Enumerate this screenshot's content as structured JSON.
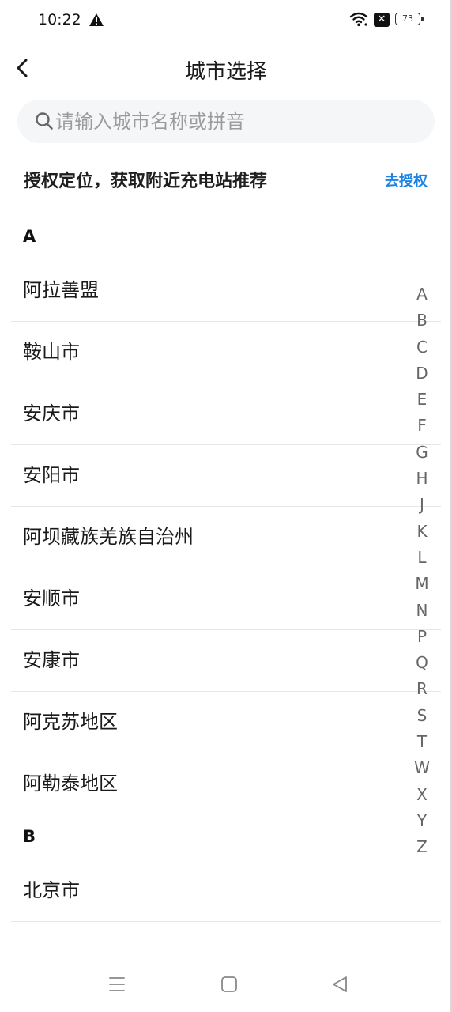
{
  "status_bar": {
    "time": "10:22",
    "battery": "73",
    "icons": [
      "warning-icon",
      "wifi-icon",
      "no-sim-icon",
      "battery-icon"
    ]
  },
  "header": {
    "title": "城市选择",
    "back_icon": "chevron-left-icon"
  },
  "search": {
    "placeholder": "请输入城市名称或拼音",
    "value": "",
    "icon": "search-icon"
  },
  "location": {
    "text": "授权定位，获取附近充电站推荐",
    "action": "去授权",
    "action_color": "#1a84e6"
  },
  "sections": [
    {
      "letter": "A",
      "cities": [
        "阿拉善盟",
        "鞍山市",
        "安庆市",
        "安阳市",
        "阿坝藏族羌族自治州",
        "安顺市",
        "安康市",
        "阿克苏地区",
        "阿勒泰地区"
      ]
    },
    {
      "letter": "B",
      "cities": [
        "北京市"
      ]
    }
  ],
  "alphabet_index": [
    "A",
    "B",
    "C",
    "D",
    "E",
    "F",
    "G",
    "H",
    "J",
    "K",
    "L",
    "M",
    "N",
    "P",
    "Q",
    "R",
    "S",
    "T",
    "W",
    "X",
    "Y",
    "Z"
  ],
  "nav_bar": {
    "icons": [
      "menu-icon",
      "home-icon",
      "back-triangle-icon"
    ]
  }
}
